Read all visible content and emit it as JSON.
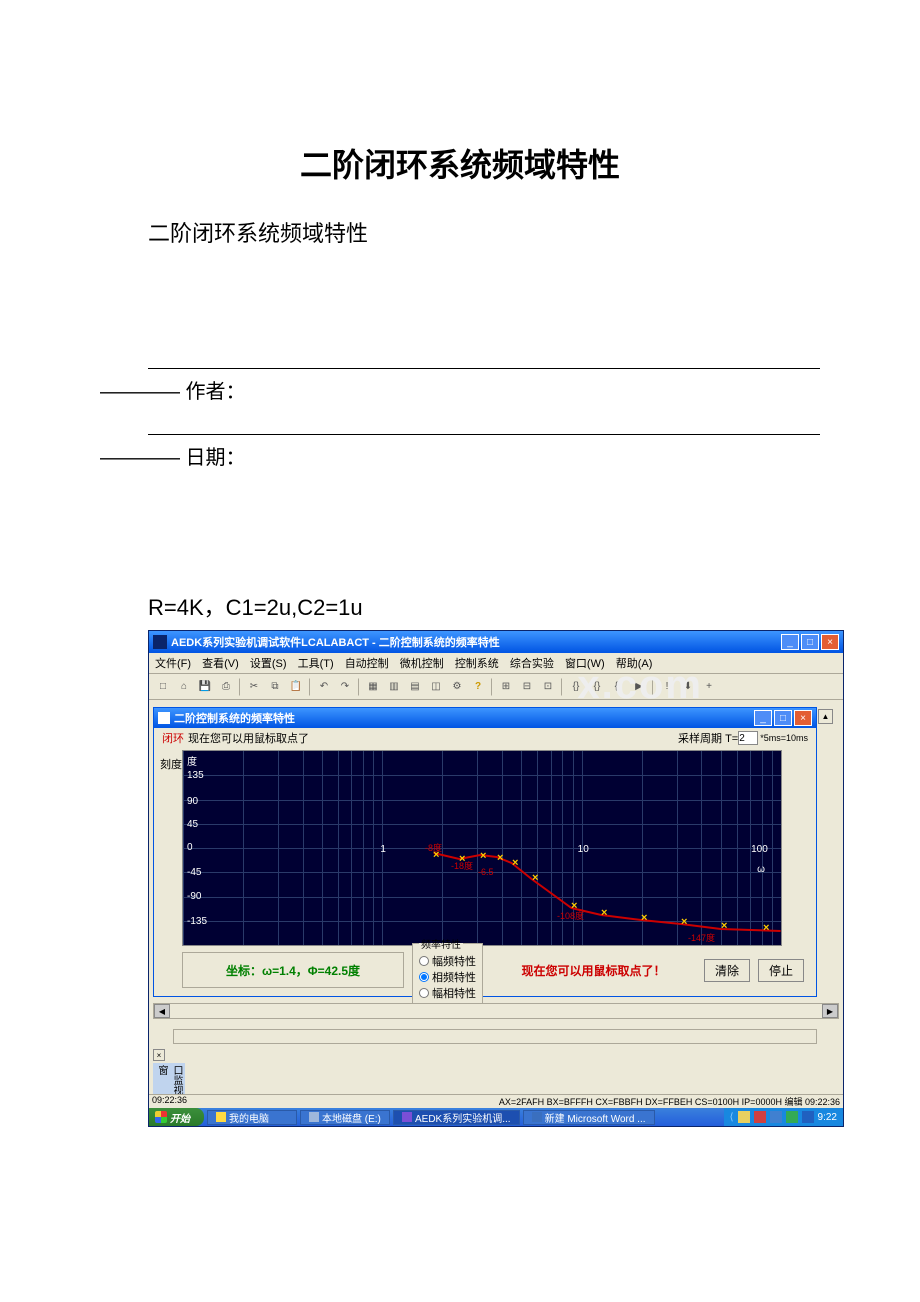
{
  "doc": {
    "title_main": "二阶闭环系统频域特性",
    "title_sub": "二阶闭环系统频域特性",
    "author_line": "———— 作者：",
    "date_line": "———— 日期：",
    "params": "R=4K，C1=2u,C2=1u"
  },
  "outer_window": {
    "title": "AEDK系列实验机调试软件LCALABACT - 二阶控制系统的频率特性",
    "min": "_",
    "max": "□",
    "close": "×"
  },
  "menu": [
    "文件(F)",
    "查看(V)",
    "设置(S)",
    "工具(T)",
    "自动控制",
    "微机控制",
    "控制系统",
    "综合实验",
    "窗口(W)",
    "帮助(A)"
  ],
  "mdi": {
    "title": "二阶控制系统的频率特性",
    "legend_marker": "闭环",
    "legend_text": "现在您可以用鼠标取点了",
    "sample_label": "采样周期 T=",
    "sample_value": "2",
    "sample_unit": "*5ms=10ms"
  },
  "ylabel": "刻度",
  "chart_data": {
    "type": "line",
    "title": "",
    "xlabel": "ω",
    "ylabel": "度",
    "ylim": [
      -180,
      180
    ],
    "x_scale": "log",
    "xlim": [
      0.1,
      200
    ],
    "y_ticks": [
      -135,
      -90,
      -45,
      0,
      45,
      90,
      135
    ],
    "x_ticks_major": [
      1,
      10,
      100
    ],
    "x_axis_extra_label": "ω",
    "series": [
      {
        "name": "相频",
        "color": "#c00",
        "marker": "x",
        "marker_color": "#ffcc00",
        "data_labels": [
          "-8度",
          "-18度",
          "-6.5",
          "",
          "",
          "",
          "-108度",
          "",
          "",
          "",
          "-147度",
          ""
        ],
        "x": [
          3.5,
          5,
          6,
          7,
          8,
          10,
          14,
          18,
          25,
          35,
          55,
          90
        ],
        "phi": [
          -8,
          -18,
          -6.5,
          -10,
          -25,
          -55,
          -108,
          -122,
          -130,
          -138,
          -147,
          -150
        ]
      }
    ]
  },
  "coord_label": "坐标：ω=1.4，Φ=42.5度",
  "freq_group_label": "频率特性",
  "radios": {
    "r1": "幅频特性",
    "r2": "相频特性",
    "r3": "幅相特性",
    "selected": "r2"
  },
  "hint_msg": "现在您可以用鼠标取点了！",
  "btn_clear": "清除",
  "btn_stop": "停止",
  "vtab": "口监视窗",
  "status_time": "09:22:36",
  "status_regs": "AX=2FAFH BX=BFFFH CX=FBBFH DX=FFBEH CS=0100H IP=0000H 编辑  09:22:36",
  "start": "开始",
  "tasks": [
    {
      "label": "我的电脑",
      "icon": "#f6e27a"
    },
    {
      "label": "本地磁盘 (E:)",
      "icon": "#9fb7db"
    },
    {
      "label": "AEDK系列实验机调...",
      "icon": "#7a4fd6",
      "active": true
    },
    {
      "label": "新建 Microsoft Word ...",
      "icon": "#3a6fbf"
    }
  ],
  "tray_time": "9:22",
  "watermark": "x.com"
}
